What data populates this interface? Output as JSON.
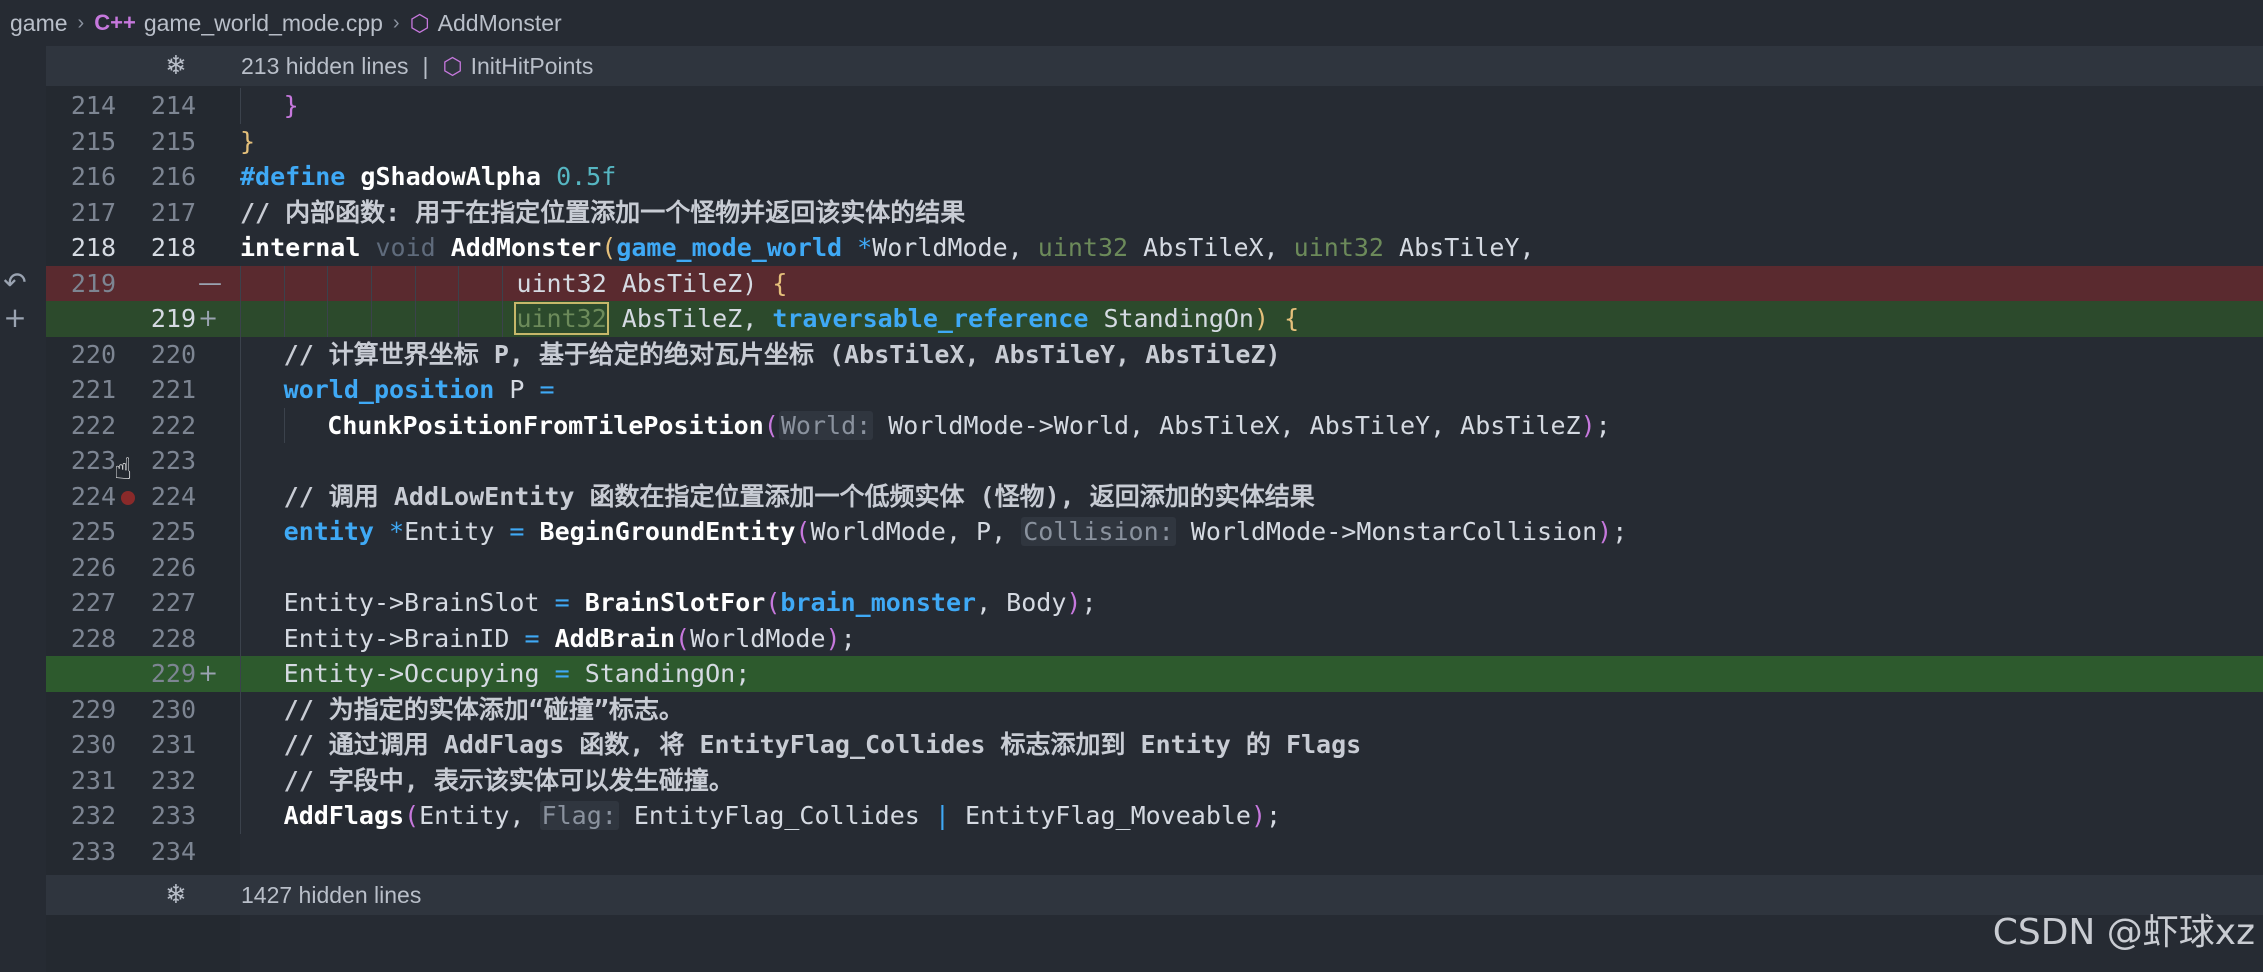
{
  "breadcrumb": {
    "items": [
      "game",
      "game_world_mode.cpp",
      "AddMonster"
    ],
    "cpp_glyph": "C++"
  },
  "fold_top": {
    "text": "213 hidden lines",
    "symbol": "InitHitPoints"
  },
  "fold_bottom": {
    "text": "1427 hidden lines"
  },
  "lines": [
    {
      "old": "214",
      "new": "214"
    },
    {
      "old": "215",
      "new": "215"
    },
    {
      "old": "216",
      "new": "216"
    },
    {
      "old": "217",
      "new": "217"
    },
    {
      "old": "218",
      "new": "218"
    },
    {
      "old": "219",
      "new": ""
    },
    {
      "old": "",
      "new": "219"
    },
    {
      "old": "220",
      "new": "220"
    },
    {
      "old": "221",
      "new": "221"
    },
    {
      "old": "222",
      "new": "222"
    },
    {
      "old": "223",
      "new": "223"
    },
    {
      "old": "224",
      "new": "224"
    },
    {
      "old": "225",
      "new": "225"
    },
    {
      "old": "226",
      "new": "226"
    },
    {
      "old": "227",
      "new": "227"
    },
    {
      "old": "228",
      "new": "228"
    },
    {
      "old": "",
      "new": "229"
    },
    {
      "old": "229",
      "new": "230"
    },
    {
      "old": "230",
      "new": "231"
    },
    {
      "old": "231",
      "new": "232"
    },
    {
      "old": "232",
      "new": "233"
    },
    {
      "old": "233",
      "new": "234"
    }
  ],
  "code": {
    "l214": "}",
    "l215": "}",
    "l216_kw": "#define",
    "l216_name": " gShadowAlpha ",
    "l216_num": "0.5f",
    "l217": "// 内部函数: 用于在指定位置添加一个怪物并返回该实体的结果",
    "l218": [
      "internal",
      " void ",
      "AddMonster",
      "(",
      "game_mode_world",
      " *",
      "WorldMode, ",
      "uint32",
      " AbsTileX, ",
      "uint32",
      " AbsTileY,"
    ],
    "l219_del": [
      "uint32 AbsTileZ) ",
      "{"
    ],
    "l219_add": [
      "uint32",
      " AbsTileZ",
      ", ",
      "traversable_reference",
      " StandingOn",
      ")",
      " {"
    ],
    "l220": "// 计算世界坐标 P, 基于给定的绝对瓦片坐标 (AbsTileX, AbsTileY, AbsTileZ)",
    "l221": [
      "world_position",
      " P ",
      "="
    ],
    "l222": [
      "ChunkPositionFromTilePosition",
      "(",
      "World:",
      " WorldMode->World, AbsTileX, AbsTileY, AbsTileZ",
      ")",
      ";"
    ],
    "l224": "// 调用 AddLowEntity 函数在指定位置添加一个低频实体 (怪物), 返回添加的实体结果",
    "l225": [
      "entity",
      " *",
      "Entity ",
      "=",
      " ",
      "BeginGroundEntity",
      "(",
      "WorldMode, P, ",
      "Collision:",
      " WorldMode->MonstarCollision",
      ")",
      ";"
    ],
    "l227": [
      "Entity->BrainSlot ",
      "=",
      " ",
      "BrainSlotFor",
      "(",
      "brain_monster",
      ", Body",
      ")",
      ";"
    ],
    "l228": [
      "Entity->BrainID ",
      "=",
      " ",
      "AddBrain",
      "(",
      "WorldMode",
      ")",
      ";"
    ],
    "l229_add": [
      "Entity->Occupying ",
      "=",
      " StandingOn;"
    ],
    "l230": "// 为指定的实体添加“碰撞”标志。",
    "l231": "// 通过调用 AddFlags 函数, 将 EntityFlag_Collides 标志添加到 Entity 的 Flags",
    "l232": "// 字段中, 表示该实体可以发生碰撞。",
    "l233": [
      "AddFlags",
      "(",
      "Entity, ",
      "Flag:",
      " EntityFlag_Collides ",
      "|",
      " EntityFlag_Moveable",
      ")",
      ";"
    ]
  },
  "watermark": "CSDN @虾球xz",
  "colors": {
    "deleted_bg": "#5a2a2f",
    "added_bg": "#2c4a2c",
    "keyword_blue": "#3fa9f5"
  }
}
